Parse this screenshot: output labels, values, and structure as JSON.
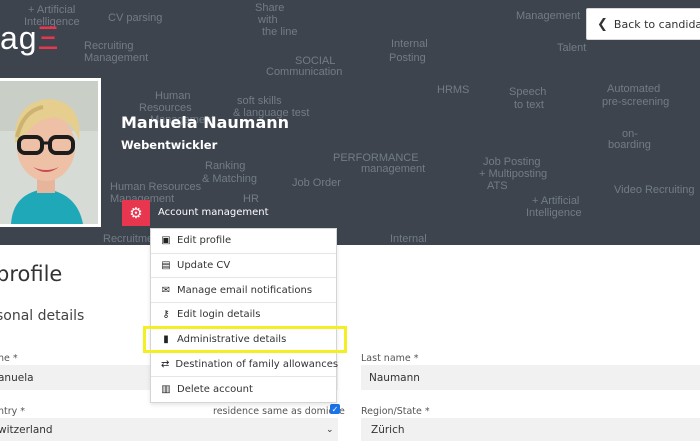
{
  "logo": {
    "text": "ag",
    "accent": "Ξ"
  },
  "back_button": {
    "label": "Back to candidate"
  },
  "profile": {
    "name": "Manuela Naumann",
    "title": "Webentwickler"
  },
  "account_menu": {
    "label": "Account management",
    "items": [
      {
        "label": "Edit profile",
        "icon": "user-card-icon",
        "glyph": "▣"
      },
      {
        "label": "Update CV",
        "icon": "clipboard-icon",
        "glyph": "▤"
      },
      {
        "label": "Manage email notifications",
        "icon": "email-icon",
        "glyph": "✉"
      },
      {
        "label": "Edit login details",
        "icon": "key-icon",
        "glyph": "⚷"
      },
      {
        "label": "Administrative details",
        "icon": "document-icon",
        "glyph": "▮"
      },
      {
        "label": "Destination of family allowances",
        "icon": "money-icon",
        "glyph": "⇄"
      },
      {
        "label": "Delete account",
        "icon": "trash-icon",
        "glyph": "▥"
      }
    ],
    "highlighted_item": "Administrative details"
  },
  "section": {
    "title": "profile",
    "subtitle": "sonal details"
  },
  "form": {
    "first_name_label": "ne *",
    "first_name_value": "anuela",
    "last_name_label": "Last name *",
    "last_name_value": "Naumann",
    "country_label": "ntry *",
    "country_value": "witzerland",
    "residence_label": "residence same as domicile",
    "residence_checked": true,
    "region_label": "Region/State *",
    "region_value": "Zürich"
  },
  "background_words": [
    "+ Artificial",
    "Intelligence",
    "CV parsing",
    "Share",
    "with",
    "the line",
    "Recruiting",
    "Management",
    "Talent",
    "Management",
    "Internal",
    "Posting",
    "SOCIAL",
    "Communication",
    "soft skills",
    "& language test",
    "Human",
    "Resources",
    "Management",
    "HRMS",
    "Speech",
    "to text",
    "Automated",
    "pre-screening",
    "Ranking",
    "& Matching",
    "PERFORMANCE",
    "management",
    "on-",
    "boarding",
    "Job Posting",
    "+ Multiposting",
    "Human Resources",
    "Management",
    "Job Order",
    "ATS",
    "+ Artificial",
    "Intelligence",
    "Video Recruiting",
    "Recruitment",
    "HR",
    "Internal"
  ]
}
